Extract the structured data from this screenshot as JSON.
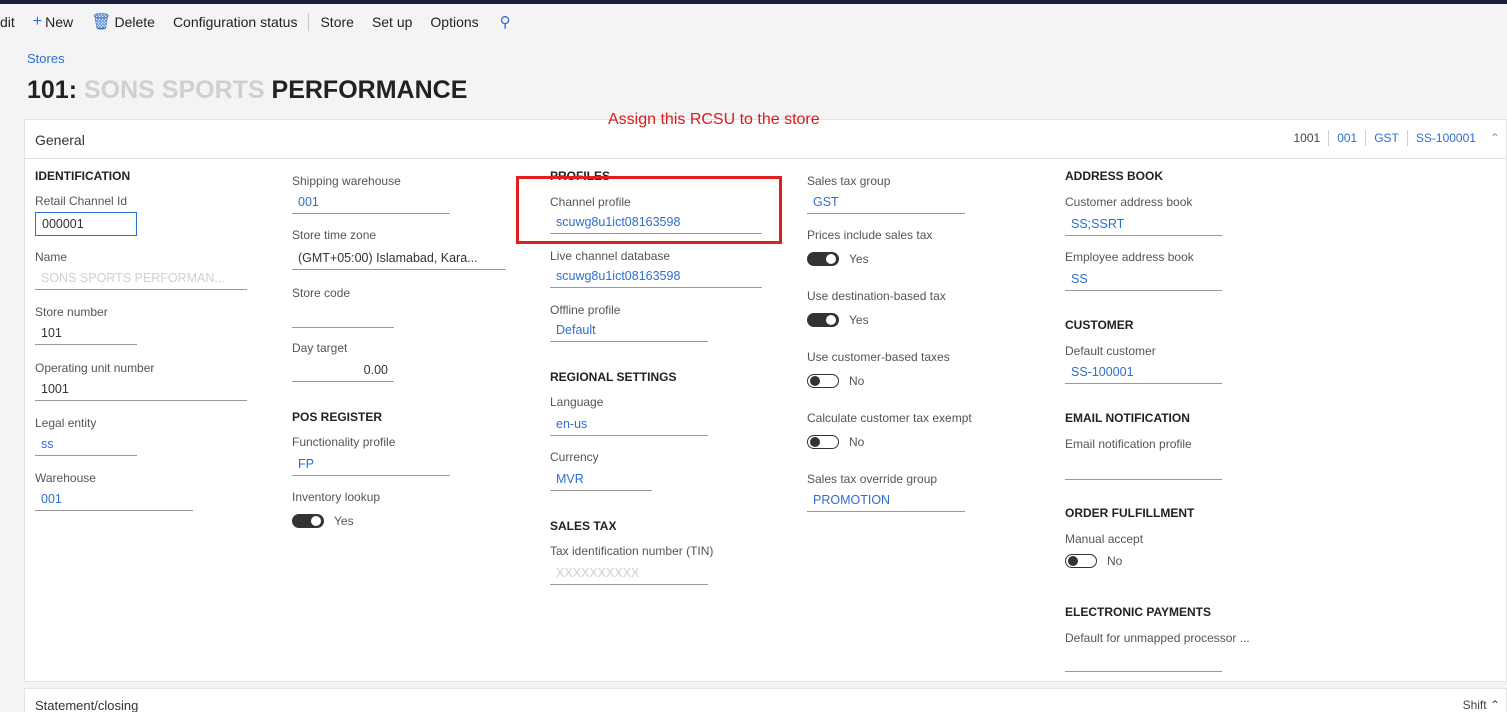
{
  "toolbar": {
    "edit_label": "dit",
    "new_label": "New",
    "delete_label": "Delete",
    "configuration_status_label": "Configuration status",
    "store_label": "Store",
    "setup_label": "Set up",
    "options_label": "Options"
  },
  "breadcrumb": "Stores",
  "page_title": {
    "prefix": "101: ",
    "faded": "SONS SPORTS ",
    "full": "PERFORMANCE"
  },
  "annotation": "Assign this RCSU to the store",
  "general": {
    "title": "General",
    "summary": [
      "1001",
      "001",
      "GST",
      "SS-100001"
    ]
  },
  "identification": {
    "heading": "IDENTIFICATION",
    "retail_channel_id_label": "Retail Channel Id",
    "retail_channel_id_value": "000001",
    "name_label": "Name",
    "name_value": "SONS SPORTS PERFORMAN...",
    "store_number_label": "Store number",
    "store_number_value": "101",
    "operating_unit_label": "Operating unit number",
    "operating_unit_value": "1001",
    "legal_entity_label": "Legal entity",
    "legal_entity_value": "ss",
    "warehouse_label": "Warehouse",
    "warehouse_value": "001"
  },
  "column2": {
    "shipping_warehouse_label": "Shipping warehouse",
    "shipping_warehouse_value": "001",
    "store_time_zone_label": "Store time zone",
    "store_time_zone_value": "(GMT+05:00) Islamabad, Kara...",
    "store_code_label": "Store code",
    "store_code_value": "",
    "day_target_label": "Day target",
    "day_target_value": "0.00",
    "pos_register_heading": "POS REGISTER",
    "functionality_profile_label": "Functionality profile",
    "functionality_profile_value": "FP",
    "inventory_lookup_label": "Inventory lookup",
    "inventory_lookup_state": "Yes"
  },
  "profiles": {
    "heading": "PROFILES",
    "channel_profile_label": "Channel profile",
    "channel_profile_value": "scuwg8u1ict08163598",
    "live_channel_db_label": "Live channel database",
    "live_channel_db_value": "scuwg8u1ict08163598",
    "offline_profile_label": "Offline profile",
    "offline_profile_value": "Default",
    "regional_heading": "REGIONAL SETTINGS",
    "language_label": "Language",
    "language_value": "en-us",
    "currency_label": "Currency",
    "currency_value": "MVR",
    "sales_tax_heading": "SALES TAX",
    "tin_label": "Tax identification number (TIN)",
    "tin_value": "XXXXXXXXXX"
  },
  "tax": {
    "sales_tax_group_label": "Sales tax group",
    "sales_tax_group_value": "GST",
    "prices_include_label": "Prices include sales tax",
    "prices_include_state": "Yes",
    "destination_based_label": "Use destination-based tax",
    "destination_based_state": "Yes",
    "customer_based_label": "Use customer-based taxes",
    "customer_based_state": "No",
    "calc_exempt_label": "Calculate customer tax exempt",
    "calc_exempt_state": "No",
    "override_group_label": "Sales tax override group",
    "override_group_value": "PROMOTION"
  },
  "address": {
    "heading": "ADDRESS BOOK",
    "customer_book_label": "Customer address book",
    "customer_book_value": "SS;SSRT",
    "employee_book_label": "Employee address book",
    "employee_book_value": "SS",
    "customer_heading": "CUSTOMER",
    "default_customer_label": "Default customer",
    "default_customer_value": "SS-100001",
    "email_heading": "EMAIL NOTIFICATION",
    "email_profile_label": "Email notification profile",
    "email_profile_value": "",
    "fulfillment_heading": "ORDER FULFILLMENT",
    "manual_accept_label": "Manual accept",
    "manual_accept_state": "No",
    "payments_heading": "ELECTRONIC PAYMENTS",
    "unmapped_label": "Default for unmapped processor ...",
    "unmapped_value": ""
  },
  "statement": {
    "title": "Statement/closing",
    "right_label": "Shift"
  },
  "colors": {
    "link": "#2c6fcf",
    "annotation": "#d81b1b",
    "highlight": "#e01f1f"
  }
}
